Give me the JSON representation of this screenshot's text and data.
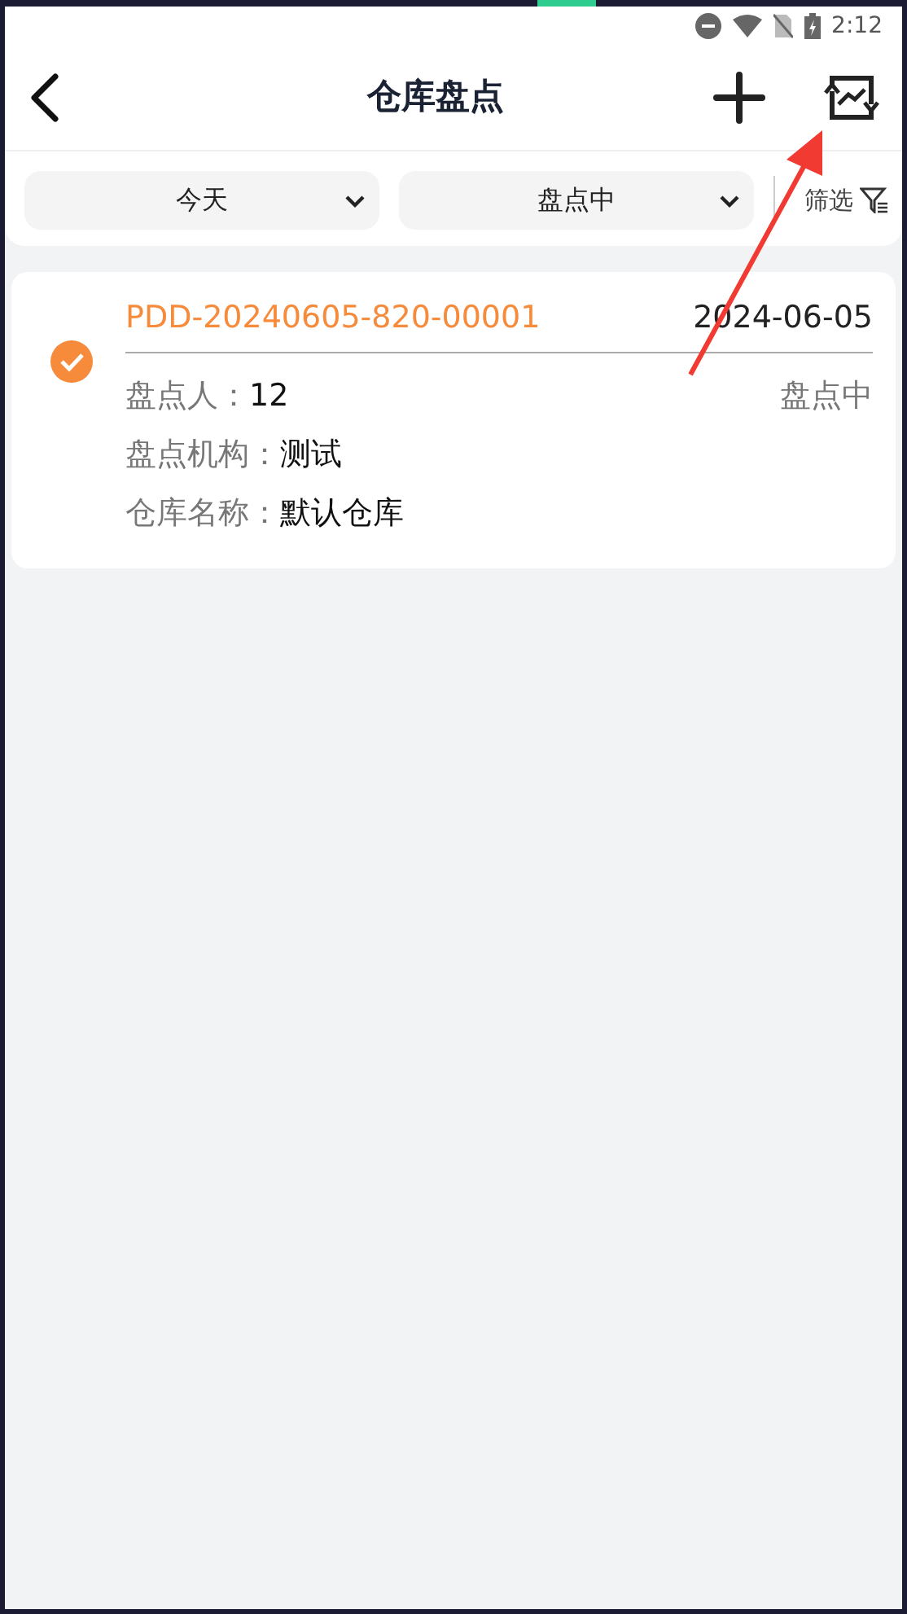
{
  "status_bar": {
    "time": "2:12"
  },
  "header": {
    "title": "仓库盘点"
  },
  "filters": {
    "dropdowns": [
      {
        "value": "今天"
      },
      {
        "value": "盘点中"
      }
    ],
    "filter_button": "筛选"
  },
  "records": [
    {
      "checked": true,
      "code": "PDD-20240605-820-00001",
      "date": "2024-06-05",
      "status": "盘点中",
      "fields": [
        {
          "label": "盘点人：",
          "value": "12"
        },
        {
          "label": "盘点机构：",
          "value": "测试"
        },
        {
          "label": "仓库名称：",
          "value": "默认仓库"
        }
      ]
    }
  ]
}
